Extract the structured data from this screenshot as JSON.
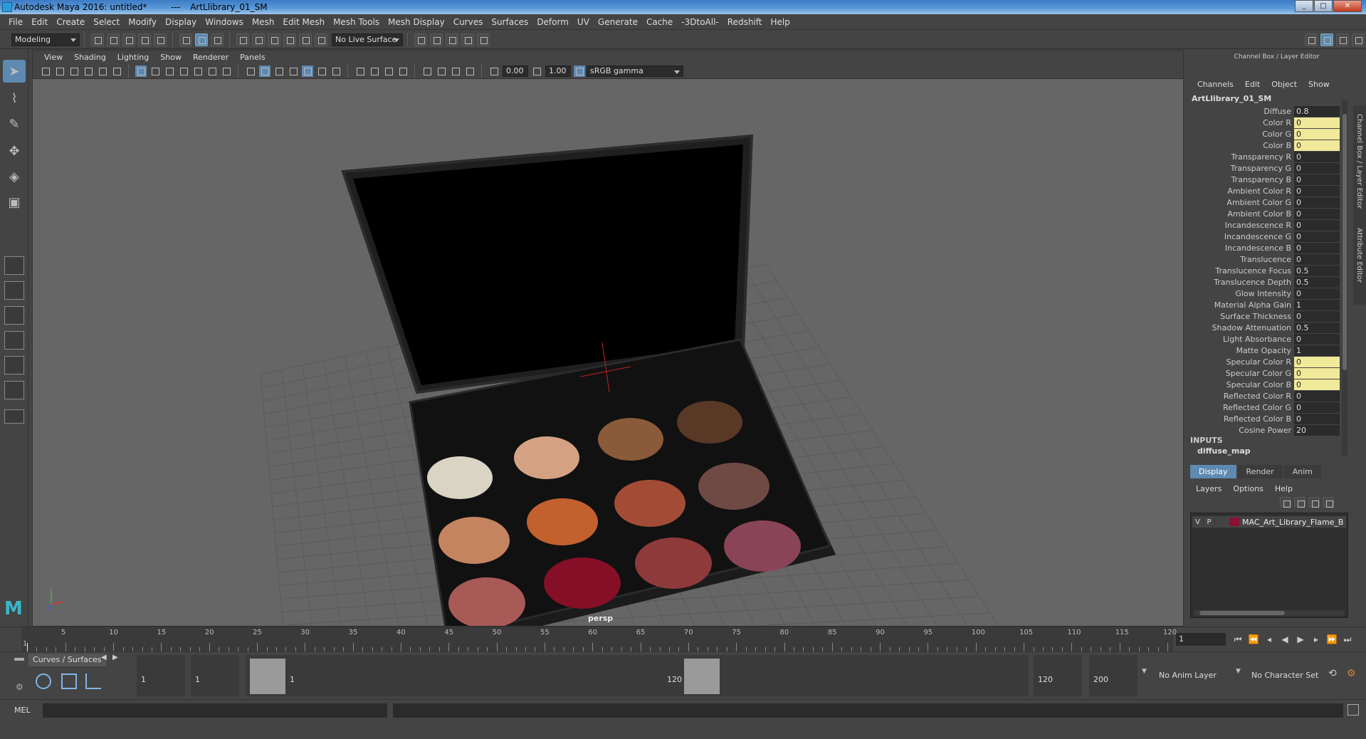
{
  "title": {
    "app": "Autodesk Maya 2016: untitled*",
    "sep": "---",
    "object": "ArtLlibrary_01_SM"
  },
  "menus": [
    "File",
    "Edit",
    "Create",
    "Select",
    "Modify",
    "Display",
    "Windows",
    "Mesh",
    "Edit Mesh",
    "Mesh Tools",
    "Mesh Display",
    "Curves",
    "Surfaces",
    "Deform",
    "UV",
    "Generate",
    "Cache",
    "-3DtoAll-",
    "Redshift",
    "Help"
  ],
  "mode": "Modeling",
  "live_surface": "No Live Surface",
  "viewport": {
    "menus": [
      "View",
      "Shading",
      "Lighting",
      "Show",
      "Renderer",
      "Panels"
    ],
    "exposure": "0.00",
    "gamma": "1.00",
    "colorspace": "sRGB gamma",
    "camera": "persp"
  },
  "channel_box": {
    "header": "Channel Box / Layer Editor",
    "menus": [
      "Channels",
      "Edit",
      "Object",
      "Show"
    ],
    "object": "ArtLlibrary_01_SM",
    "channels": [
      {
        "label": "Diffuse",
        "value": "0.8",
        "keyed": false
      },
      {
        "label": "Color R",
        "value": "0",
        "keyed": true
      },
      {
        "label": "Color G",
        "value": "0",
        "keyed": true
      },
      {
        "label": "Color B",
        "value": "0",
        "keyed": true
      },
      {
        "label": "Transparency R",
        "value": "0",
        "keyed": false
      },
      {
        "label": "Transparency G",
        "value": "0",
        "keyed": false
      },
      {
        "label": "Transparency B",
        "value": "0",
        "keyed": false
      },
      {
        "label": "Ambient Color R",
        "value": "0",
        "keyed": false
      },
      {
        "label": "Ambient Color G",
        "value": "0",
        "keyed": false
      },
      {
        "label": "Ambient Color B",
        "value": "0",
        "keyed": false
      },
      {
        "label": "Incandescence R",
        "value": "0",
        "keyed": false
      },
      {
        "label": "Incandescence G",
        "value": "0",
        "keyed": false
      },
      {
        "label": "Incandescence B",
        "value": "0",
        "keyed": false
      },
      {
        "label": "Translucence",
        "value": "0",
        "keyed": false
      },
      {
        "label": "Translucence Focus",
        "value": "0.5",
        "keyed": false
      },
      {
        "label": "Translucence Depth",
        "value": "0.5",
        "keyed": false
      },
      {
        "label": "Glow Intensity",
        "value": "0",
        "keyed": false
      },
      {
        "label": "Material Alpha Gain",
        "value": "1",
        "keyed": false
      },
      {
        "label": "Surface Thickness",
        "value": "0",
        "keyed": false
      },
      {
        "label": "Shadow Attenuation",
        "value": "0.5",
        "keyed": false
      },
      {
        "label": "Light Absorbance",
        "value": "0",
        "keyed": false
      },
      {
        "label": "Matte Opacity",
        "value": "1",
        "keyed": false
      },
      {
        "label": "Specular Color R",
        "value": "0",
        "keyed": true
      },
      {
        "label": "Specular Color G",
        "value": "0",
        "keyed": true
      },
      {
        "label": "Specular Color B",
        "value": "0",
        "keyed": true
      },
      {
        "label": "Reflected Color R",
        "value": "0",
        "keyed": false
      },
      {
        "label": "Reflected Color G",
        "value": "0",
        "keyed": false
      },
      {
        "label": "Reflected Color B",
        "value": "0",
        "keyed": false
      },
      {
        "label": "Cosine Power",
        "value": "20",
        "keyed": false
      }
    ],
    "inputs_label": "INPUTS",
    "inputs_value": "diffuse_map",
    "side_tabs": [
      "Channel Box / Layer Editor",
      "Attribute Editor"
    ]
  },
  "layer_editor": {
    "tabs": [
      "Display",
      "Render",
      "Anim"
    ],
    "menus": [
      "Layers",
      "Options",
      "Help"
    ],
    "layer": {
      "v": "V",
      "p": "P",
      "name": "MAC_Art_Library_Flame_B",
      "color": "#8a1131"
    }
  },
  "timeline": {
    "ticks": [
      "1",
      "5",
      "10",
      "15",
      "20",
      "25",
      "30",
      "35",
      "40",
      "45",
      "50",
      "55",
      "60",
      "65",
      "70",
      "75",
      "80",
      "85",
      "90",
      "95",
      "100",
      "105",
      "110",
      "115",
      "120"
    ],
    "current_frame": "1"
  },
  "range": {
    "shelf_tab": "Curves / Surfaces",
    "start": "1",
    "start2": "1",
    "slider_start": "1",
    "slider_end": "120",
    "end": "120",
    "end2": "200",
    "anim_layer": "No Anim Layer",
    "char_set": "No Character Set"
  },
  "cmd": {
    "lang": "MEL"
  },
  "palette_colors": [
    "#d9d4c4",
    "#d4a283",
    "#8b5a3a",
    "#5a3826",
    "#c58460",
    "#c2602e",
    "#a24c36",
    "#6f4a44",
    "#a85a57",
    "#850f26",
    "#8e3a3a",
    "#8a4457"
  ]
}
